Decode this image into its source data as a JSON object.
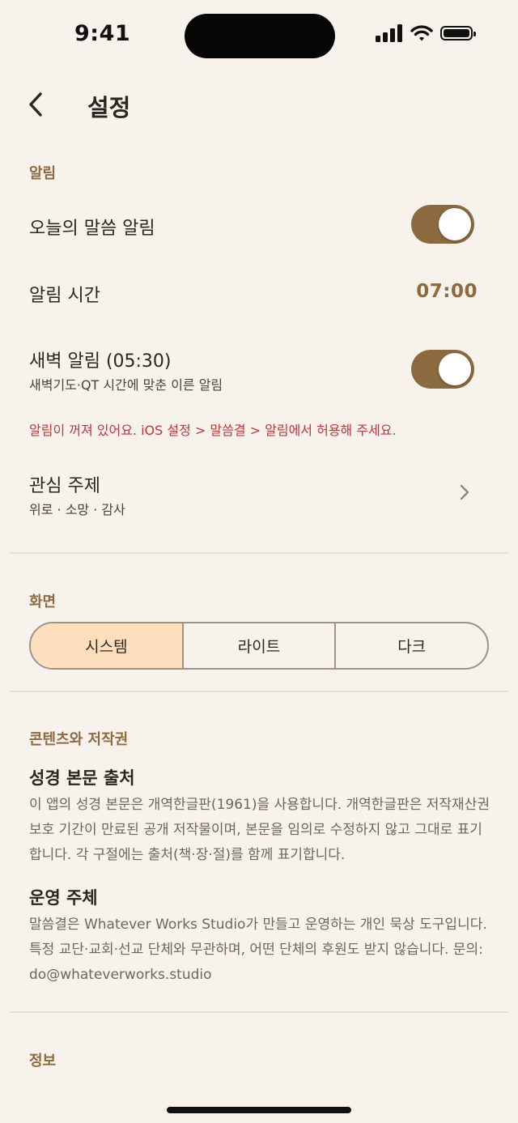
{
  "status_bar": {
    "time": "9:41"
  },
  "nav": {
    "title": "설정"
  },
  "notifications": {
    "section_label": "알림",
    "daily_word": {
      "label": "오늘의 말씀 알림",
      "enabled": true
    },
    "alarm_time": {
      "label": "알림 시간",
      "value": "07:00"
    },
    "dawn": {
      "label": "새벽 알림 (05:30)",
      "sub": "새벽기도·QT 시간에 맞춘 이른 알림",
      "enabled": true
    },
    "warning": "알림이 꺼져 있어요. iOS 설정 > 말씀결 > 알림에서 허용해 주세요.",
    "topics": {
      "label": "관심 주제",
      "value": "위로 · 소망 · 감사"
    }
  },
  "display": {
    "section_label": "화면",
    "options": [
      "시스템",
      "라이트",
      "다크"
    ],
    "selected": "시스템"
  },
  "content": {
    "section_label": "콘텐츠와 저작권",
    "source_title": "성경 본문 출처",
    "source_text": "이 앱의 성경 본문은 개역한글판(1961)을 사용합니다. 개역한글판은 저작재산권 보호 기간이 만료된 공개 저작물이며, 본문을 임의로 수정하지 않고 그대로 표기합니다. 각 구절에는 출처(책·장·절)를 함께 표기합니다.",
    "operator_title": "운영 주체",
    "operator_text": "말씀결은 Whatever Works Studio가 만들고 운영하는 개인 묵상 도구입니다. 특정 교단·교회·선교 단체와 무관하며, 어떤 단체의 후원도 받지 않습니다. 문의: do@whateverworks.studio"
  },
  "info": {
    "section_label": "정보"
  },
  "colors": {
    "accent": "#8A6A3E",
    "warning": "#C4353A",
    "segment_active": "#FDDFBE",
    "background": "#F7F2EC"
  }
}
